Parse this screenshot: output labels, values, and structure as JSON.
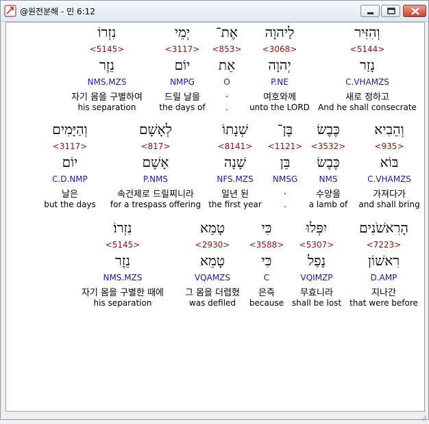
{
  "window": {
    "title": "@원전분해 - 민 6:12"
  },
  "rows": [
    [
      {
        "heb": "וְהִזִּיר",
        "strong": "<5144>",
        "root": "נָזַר",
        "morph": "C.VHAMZS",
        "kor": "새로 정하고",
        "eng": "And he shall consecrate"
      },
      {
        "heb": "לַיהוָה",
        "strong": "<3068>",
        "root": "יְהוָה",
        "morph": "P.NE",
        "kor": "여호와께",
        "eng": "unto the LORD"
      },
      {
        "heb": "אֶת־",
        "strong": "<853>",
        "root": "אֵת",
        "morph": "O",
        "kor": ".",
        "eng": "."
      },
      {
        "heb": "יְמֵי",
        "strong": "<3117>",
        "root": "יוֹם",
        "morph": "NMPG",
        "kor": "드릴 날을",
        "eng": "the days of"
      },
      {
        "heb": "נִזְרוֹ",
        "strong": "<5145>",
        "root": "נֵזֶר",
        "morph": "NMS.MZS",
        "kor": "자기 몸을 구별하여",
        "eng": "his separation"
      }
    ],
    [
      {
        "heb": "וְהֵבִיא",
        "strong": "<935>",
        "root": "בּוֹא",
        "morph": "C.VHAMZS",
        "kor": "가져다가",
        "eng": "and shall bring"
      },
      {
        "heb": "כֶּבֶשׂ",
        "strong": "<3532>",
        "root": "כֶּבֶשׂ",
        "morph": "NMS",
        "kor": "수양을",
        "eng": "a lamb of"
      },
      {
        "heb": "בֶּן־",
        "strong": "<1121>",
        "root": "בֵּן",
        "morph": "NMSG",
        "kor": ".",
        "eng": "."
      },
      {
        "heb": "שְׁנָתוֹ",
        "strong": "<8141>",
        "root": "שָׁנָה",
        "morph": "NFS.MZS",
        "kor": "일년 된",
        "eng": "the first year"
      },
      {
        "heb": "לְאָשָׁם",
        "strong": "<817>",
        "root": "אָשָׁם",
        "morph": "P.NMS",
        "kor": "속건제로 드릴찌니라",
        "eng": "for a trespass offering"
      },
      {
        "heb": "וְהַיָּמִים",
        "strong": "<3117>",
        "root": "יוֹם",
        "morph": "C.D.NMP",
        "kor": "날은",
        "eng": "but the days"
      }
    ],
    [
      {
        "heb": "הָרִאשֹׁנִים",
        "strong": "<7223>",
        "root": "רִאשׁוֹן",
        "morph": "D.AMP",
        "kor": "지나간",
        "eng": "that were before"
      },
      {
        "heb": "יִפְּלוּ",
        "strong": "<5307>",
        "root": "נָפַל",
        "morph": "VQIMZP",
        "kor": "무효니라",
        "eng": "shall be lost"
      },
      {
        "heb": "כִּי",
        "strong": "<3588>",
        "root": "כִּי",
        "morph": "C",
        "kor": "은즉",
        "eng": "because"
      },
      {
        "heb": "טָמֵא",
        "strong": "<2930>",
        "root": "טָמֵא",
        "morph": "VQAMZS",
        "kor": "그 몸을 더렵혔",
        "eng": "was defiled"
      },
      {
        "heb": "נִזְרוֹ׃",
        "strong": "<5145>",
        "root": "נֵזֶר",
        "morph": "NMS.MZS",
        "kor": "자기 몸을 구별한 때에",
        "eng": "his separation"
      }
    ]
  ]
}
